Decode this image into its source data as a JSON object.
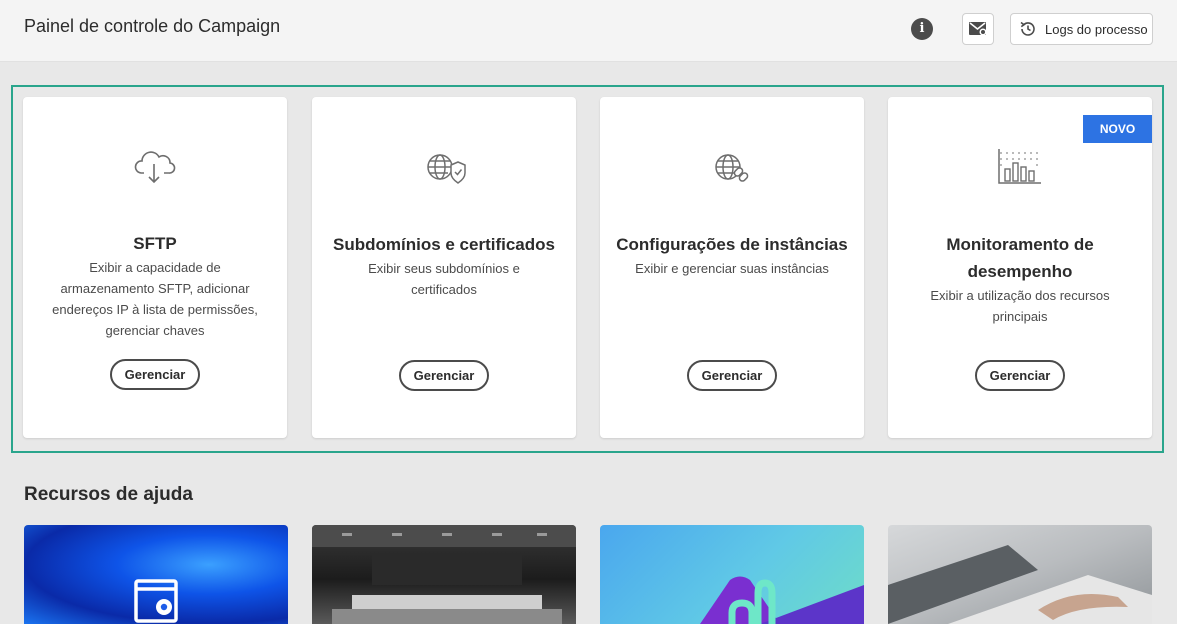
{
  "header": {
    "title": "Painel de controle do Campaign",
    "info_label": "i",
    "logs_label": "Logs do processo"
  },
  "cards": [
    {
      "title": "SFTP",
      "description": "Exibir a capacidade de armazenamento SFTP, adicionar endereços IP à lista de permissões, gerenciar chaves",
      "button": "Gerenciar",
      "icon": "cloud-download-icon"
    },
    {
      "title": "Subdomínios e certificados",
      "description": "Exibir seus subdomínios e certificados",
      "button": "Gerenciar",
      "icon": "globe-shield-icon"
    },
    {
      "title": "Configurações de instâncias",
      "description": "Exibir e gerenciar suas instâncias",
      "button": "Gerenciar",
      "icon": "globe-link-icon"
    },
    {
      "title": "Monitoramento de desempenho",
      "description": "Exibir a utilização dos recursos principais",
      "button": "Gerenciar",
      "icon": "bar-chart-icon",
      "badge": "NOVO"
    }
  ],
  "help": {
    "title": "Recursos de ajuda"
  },
  "colors": {
    "accent": "#2d73e3",
    "highlight": "#2aa58c"
  }
}
